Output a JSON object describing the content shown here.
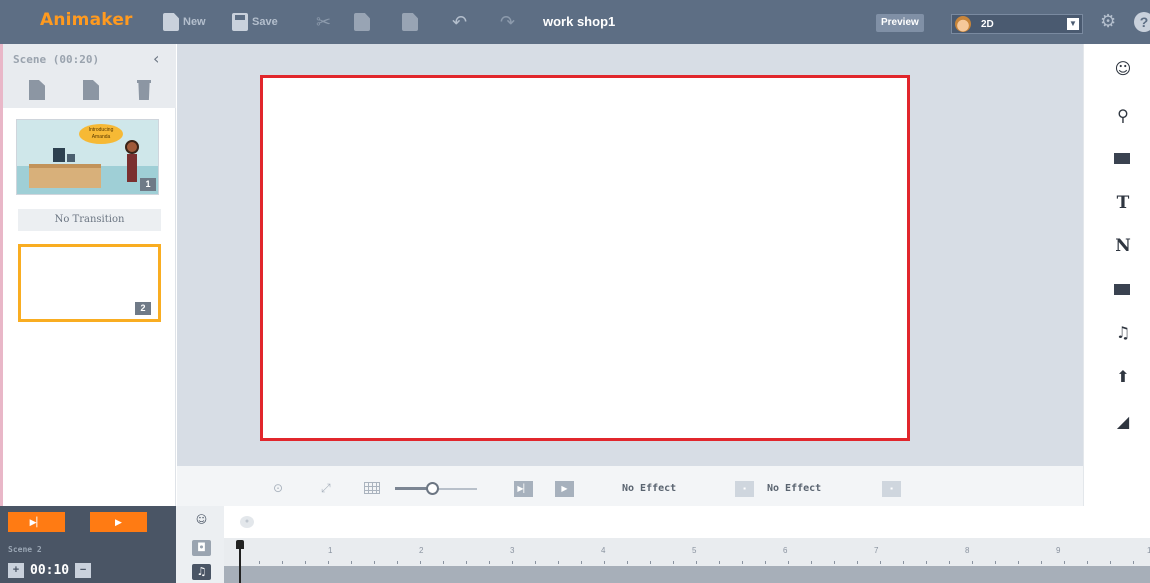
{
  "app": {
    "logo": "Animaker",
    "project_title": "work shop1"
  },
  "toolbar": {
    "new_label": "New",
    "save_label": "Save",
    "preview_label": "Preview",
    "mode_value": "2D"
  },
  "left_panel": {
    "scene_title": "Scene (00:20)",
    "transition_label": "No Transition",
    "scenes": [
      {
        "number": "1",
        "bubble_text": "Introducing Amanda"
      },
      {
        "number": "2"
      }
    ]
  },
  "stage_toolbar": {
    "effect_in": "No Effect",
    "effect_out": "No Effect",
    "zoom_level": 0.45
  },
  "timeline": {
    "scene_label": "Scene 2",
    "duration": "00:10",
    "ruler": [
      "1",
      "2",
      "3",
      "4",
      "5",
      "6",
      "7",
      "8",
      "9",
      "1"
    ]
  },
  "right_panel": {
    "text_tool": "T",
    "number_tool": "N"
  },
  "colors": {
    "accent": "#ff9a1f",
    "stage_border": "#e1262c",
    "selected_scene": "#f9ad21",
    "topbar": "#5d6e84"
  }
}
